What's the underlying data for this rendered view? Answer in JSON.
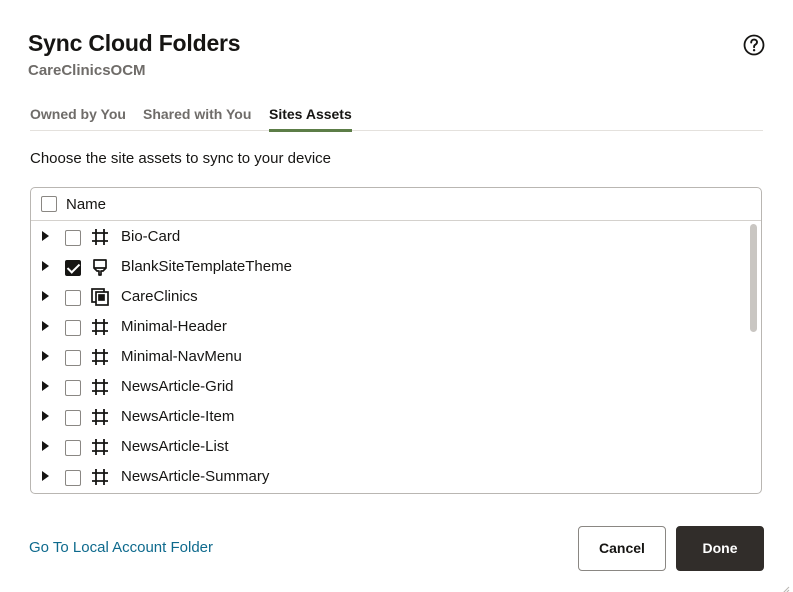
{
  "dialog": {
    "title": "Sync Cloud Folders",
    "subtitle": "CareClinicsOCM",
    "help_icon": "question-circle-icon"
  },
  "tabs": [
    {
      "label": "Owned by You",
      "active": false
    },
    {
      "label": "Shared with You",
      "active": false
    },
    {
      "label": "Sites Assets",
      "active": true
    }
  ],
  "instructions": "Choose the site assets to sync to your device",
  "table": {
    "header": {
      "name_label": "Name",
      "select_all_checked": false
    },
    "rows": [
      {
        "label": "Bio-Card",
        "checked": false,
        "icon": "component-icon"
      },
      {
        "label": "BlankSiteTemplateTheme",
        "checked": true,
        "icon": "theme-icon"
      },
      {
        "label": "CareClinics",
        "checked": false,
        "icon": "site-template-icon"
      },
      {
        "label": "Minimal-Header",
        "checked": false,
        "icon": "component-icon"
      },
      {
        "label": "Minimal-NavMenu",
        "checked": false,
        "icon": "component-icon"
      },
      {
        "label": "NewsArticle-Grid",
        "checked": false,
        "icon": "component-icon"
      },
      {
        "label": "NewsArticle-Item",
        "checked": false,
        "icon": "component-icon"
      },
      {
        "label": "NewsArticle-List",
        "checked": false,
        "icon": "component-icon"
      },
      {
        "label": "NewsArticle-Summary",
        "checked": false,
        "icon": "component-icon"
      }
    ]
  },
  "footer": {
    "link_label": "Go To Local Account Folder",
    "cancel_label": "Cancel",
    "done_label": "Done"
  },
  "colors": {
    "accent_tab_underline": "#5c7d47",
    "link": "#0e6a8d",
    "primary_button": "#312d2a"
  }
}
